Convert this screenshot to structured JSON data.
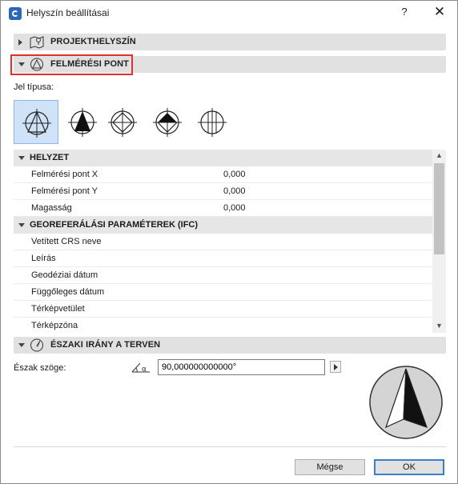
{
  "window": {
    "title": "Helyszín beállításai",
    "help": "?",
    "close": "✕"
  },
  "sections": {
    "projekt": {
      "label": "PROJEKTHELYSZÍN",
      "icon": "map-pin-icon"
    },
    "felmeresi": {
      "label": "FELMÉRÉSI PONT",
      "icon": "survey-point-icon"
    },
    "eszaki": {
      "label": "ÉSZAKI IRÁNY A TERVEN",
      "icon": "compass-needle-icon"
    }
  },
  "symbol_type": {
    "label": "Jel típusa:",
    "options": [
      "survey-symbol-1-icon",
      "survey-symbol-2-icon",
      "survey-symbol-3-icon",
      "survey-symbol-4-icon",
      "survey-symbol-5-icon"
    ],
    "selected_index": 0
  },
  "grid": {
    "helyzet": {
      "label": "HELYZET",
      "rows": [
        {
          "label": "Felmérési pont X",
          "value": "0,000"
        },
        {
          "label": "Felmérési pont Y",
          "value": "0,000"
        },
        {
          "label": "Magasság",
          "value": "0,000"
        }
      ]
    },
    "georef": {
      "label": "GEOREFERÁLÁSI PARAMÉTEREK (IFC)",
      "rows": [
        {
          "label": "Vetített CRS neve",
          "value": ""
        },
        {
          "label": "Leírás",
          "value": ""
        },
        {
          "label": "Geodéziai dátum",
          "value": ""
        },
        {
          "label": "Függőleges dátum",
          "value": ""
        },
        {
          "label": "Térképvetület",
          "value": ""
        },
        {
          "label": "Térképzóna",
          "value": ""
        }
      ]
    }
  },
  "north": {
    "label": "Észak szöge:",
    "value": "90,000000000000°",
    "icon": "angle-icon"
  },
  "buttons": {
    "cancel": "Mégse",
    "ok": "OK"
  },
  "colors": {
    "accent": "#3c7fd1",
    "selection": "#cfe2f7",
    "highlight": "#e03030"
  }
}
